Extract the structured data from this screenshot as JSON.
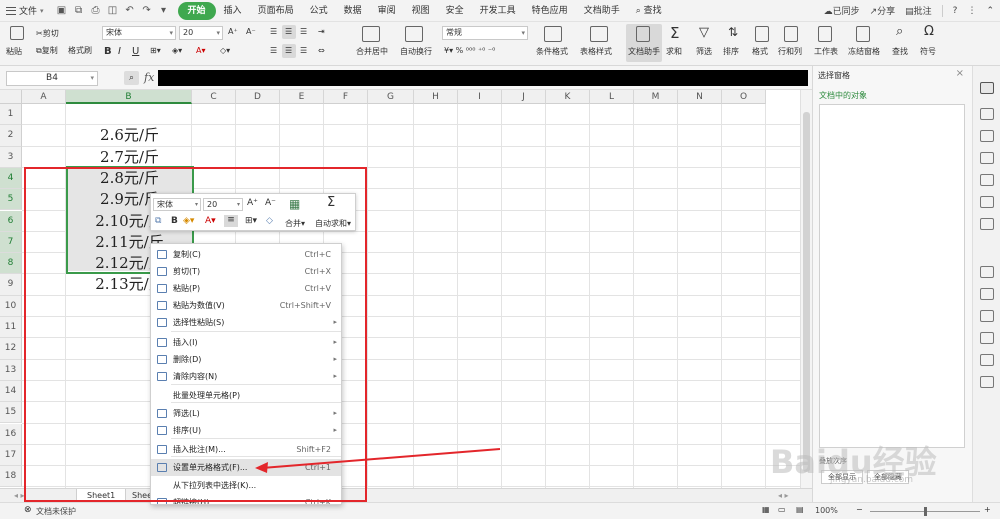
{
  "menubar": {
    "file_label": "文件",
    "tabs": [
      "开始",
      "插入",
      "页面布局",
      "公式",
      "数据",
      "审阅",
      "视图",
      "安全",
      "开发工具",
      "特色应用",
      "文档助手"
    ],
    "active_tab": "开始",
    "search_label": "查找",
    "sync_label": "已同步",
    "share_label": "分享",
    "comment_label": "批注"
  },
  "ribbon": {
    "paste": "粘贴",
    "cut": "剪切",
    "copy": "复制",
    "format_painter": "格式刷",
    "font_name": "宋体",
    "font_size": "20",
    "merge_center": "合并居中",
    "auto_wrap": "自动换行",
    "number_format": "常规",
    "cond_format": "条件格式",
    "table_style": "表格样式",
    "doc_assistant": "文档助手",
    "sum": "求和",
    "filter": "筛选",
    "sort": "排序",
    "format": "格式",
    "rows_cols": "行和列",
    "worksheet": "工作表",
    "freeze": "冻结窗格",
    "find": "查找",
    "symbol": "符号"
  },
  "formula_bar": {
    "name_box": "B4",
    "fx": "fx"
  },
  "grid": {
    "columns": [
      "A",
      "B",
      "C",
      "D",
      "E",
      "F",
      "G",
      "H",
      "I",
      "J",
      "K",
      "L",
      "M",
      "N",
      "O"
    ],
    "rows": [
      "1",
      "2",
      "3",
      "4",
      "5",
      "6",
      "7",
      "8",
      "9",
      "10",
      "11",
      "12",
      "13",
      "14",
      "15",
      "16",
      "17",
      "18"
    ],
    "b_values": [
      "2.6元/斤",
      "2.7元/斤",
      "2.8元/斤",
      "2.9元/斤",
      "2.10元/斤",
      "2.11元/斤",
      "2.12元/斤",
      "2.13元/斤"
    ]
  },
  "sheets": [
    "Sheet1",
    "Sheet"
  ],
  "status": {
    "protect": "文档未保护",
    "zoom": "100%"
  },
  "pane": {
    "title": "选择窗格",
    "subtitle": "文档中的对象",
    "btn_show_all": "全部显示",
    "btn_hide_all": "全部隐藏",
    "order_label": "叠放次序"
  },
  "mini_toolbar": {
    "font": "宋体",
    "size": "20",
    "merge": "合并",
    "auto_sum": "自动求和"
  },
  "context_menu": [
    {
      "label": "复制(C)",
      "shortcut": "Ctrl+C",
      "arrow": false
    },
    {
      "label": "剪切(T)",
      "shortcut": "Ctrl+X",
      "arrow": false
    },
    {
      "label": "粘贴(P)",
      "shortcut": "Ctrl+V",
      "arrow": false
    },
    {
      "label": "粘贴为数值(V)",
      "shortcut": "Ctrl+Shift+V",
      "arrow": false
    },
    {
      "label": "选择性粘贴(S)",
      "shortcut": "",
      "arrow": true
    },
    {
      "label": "插入(I)",
      "shortcut": "",
      "arrow": true
    },
    {
      "label": "删除(D)",
      "shortcut": "",
      "arrow": true
    },
    {
      "label": "清除内容(N)",
      "shortcut": "",
      "arrow": true
    },
    {
      "label": "批量处理单元格(P)",
      "shortcut": "",
      "arrow": false
    },
    {
      "label": "筛选(L)",
      "shortcut": "",
      "arrow": true
    },
    {
      "label": "排序(U)",
      "shortcut": "",
      "arrow": true
    },
    {
      "label": "插入批注(M)...",
      "shortcut": "Shift+F2",
      "arrow": false
    },
    {
      "label": "设置单元格格式(F)...",
      "shortcut": "Ctrl+1",
      "arrow": false
    },
    {
      "label": "从下拉列表中选择(K)...",
      "shortcut": "",
      "arrow": false
    },
    {
      "label": "超链接(H)...",
      "shortcut": "Ctrl+K",
      "arrow": false
    }
  ],
  "watermark": {
    "brand": "Baidu经验",
    "url": "jingyan.baidu.com"
  },
  "colors": {
    "accent": "#3fa84f",
    "selection": "#3a9a4a",
    "annotation": "#e3262b"
  }
}
